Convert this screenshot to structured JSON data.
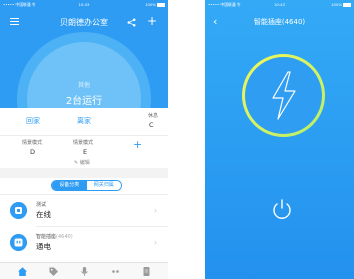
{
  "left_screen": {
    "status": {
      "carrier": "••••• 中国联通 令",
      "time": "10:43",
      "battery": "100%"
    },
    "title": "贝朗德办公室",
    "summary": {
      "label": "其他",
      "value": "2台运行"
    },
    "modes": {
      "home": "回家",
      "away": "离家",
      "rest_label": "休息",
      "rest_value": "C"
    },
    "scenes": [
      {
        "label": "情景模式",
        "value": "D"
      },
      {
        "label": "情景模式",
        "value": "E"
      }
    ],
    "edit_label": "✎ 编辑",
    "segments": {
      "active": "设备分类",
      "inactive": "网关归属"
    },
    "devices": [
      {
        "name": "测试",
        "id": "",
        "state": "在线"
      },
      {
        "name": "智能插座",
        "id": "(4640)",
        "state": "通电"
      }
    ],
    "tab_icons": [
      "home-icon",
      "tag-icon",
      "mic-icon",
      "dots-icon",
      "doc-icon"
    ],
    "colors": {
      "accent": "#2f9cf3",
      "header": "#2f9cf3"
    }
  },
  "right_screen": {
    "status": {
      "carrier": "••••• 中国联通 令",
      "time": "10:43",
      "battery": "100%"
    },
    "title": "智能插座(4640)",
    "colors": {
      "background": "#2a9bf0",
      "ring": "#d7f25a"
    }
  }
}
